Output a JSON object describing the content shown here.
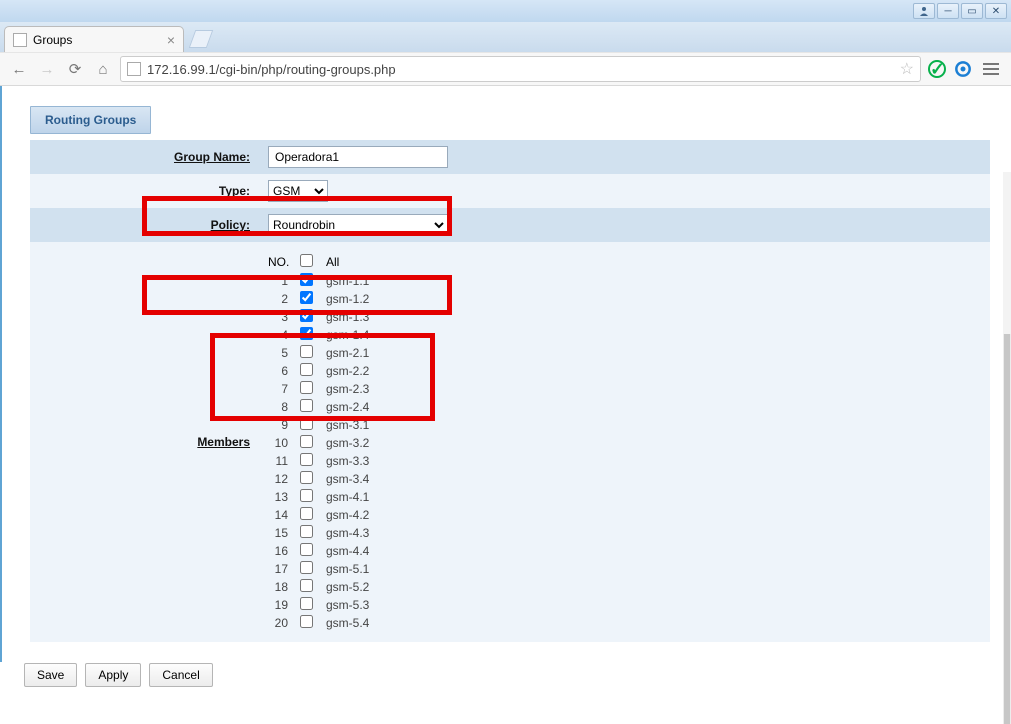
{
  "window": {
    "buttons": [
      "user",
      "min",
      "max",
      "close"
    ]
  },
  "tab": {
    "title": "Groups"
  },
  "url": "172.16.99.1/cgi-bin/php/routing-groups.php",
  "header": {
    "title": "Routing Groups"
  },
  "form": {
    "group_name_label": "Group Name:",
    "group_name_value": "Operadora1",
    "type_label": "Type:",
    "type_value": "GSM",
    "policy_label": "Policy:",
    "policy_value": "Roundrobin",
    "members_label": "Members"
  },
  "members": {
    "col_no": "NO.",
    "all_label": "All",
    "all_checked": false,
    "items": [
      {
        "no": 1,
        "label": "gsm-1.1",
        "checked": true
      },
      {
        "no": 2,
        "label": "gsm-1.2",
        "checked": true
      },
      {
        "no": 3,
        "label": "gsm-1.3",
        "checked": true
      },
      {
        "no": 4,
        "label": "gsm-1.4",
        "checked": true
      },
      {
        "no": 5,
        "label": "gsm-2.1",
        "checked": false
      },
      {
        "no": 6,
        "label": "gsm-2.2",
        "checked": false
      },
      {
        "no": 7,
        "label": "gsm-2.3",
        "checked": false
      },
      {
        "no": 8,
        "label": "gsm-2.4",
        "checked": false
      },
      {
        "no": 9,
        "label": "gsm-3.1",
        "checked": false
      },
      {
        "no": 10,
        "label": "gsm-3.2",
        "checked": false
      },
      {
        "no": 11,
        "label": "gsm-3.3",
        "checked": false
      },
      {
        "no": 12,
        "label": "gsm-3.4",
        "checked": false
      },
      {
        "no": 13,
        "label": "gsm-4.1",
        "checked": false
      },
      {
        "no": 14,
        "label": "gsm-4.2",
        "checked": false
      },
      {
        "no": 15,
        "label": "gsm-4.3",
        "checked": false
      },
      {
        "no": 16,
        "label": "gsm-4.4",
        "checked": false
      },
      {
        "no": 17,
        "label": "gsm-5.1",
        "checked": false
      },
      {
        "no": 18,
        "label": "gsm-5.2",
        "checked": false
      },
      {
        "no": 19,
        "label": "gsm-5.3",
        "checked": false
      },
      {
        "no": 20,
        "label": "gsm-5.4",
        "checked": false
      }
    ]
  },
  "buttons": {
    "save": "Save",
    "apply": "Apply",
    "cancel": "Cancel"
  }
}
